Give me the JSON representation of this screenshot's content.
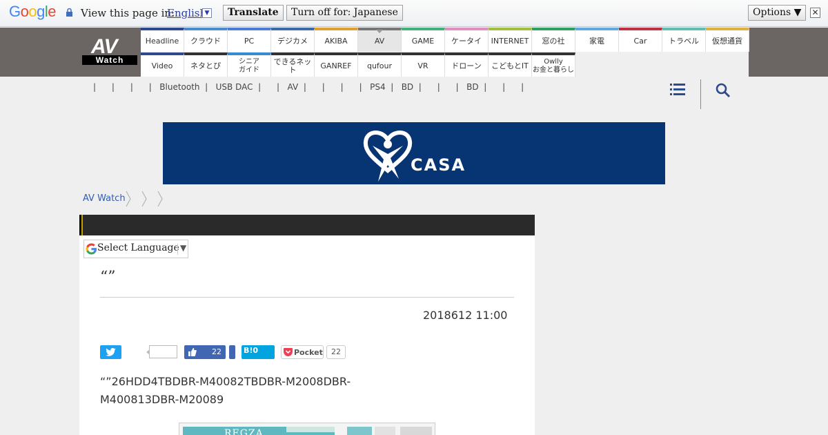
{
  "translate_bar": {
    "logo": "Google",
    "view_text": "View this page in:",
    "language": "English",
    "translate_button": "Translate",
    "turn_off_button": "Turn off for: Japanese",
    "options_button": "Options ▼",
    "close_symbol": "✕"
  },
  "site": {
    "logo_av": "AV",
    "logo_watch": "Watch"
  },
  "nav": {
    "row1": [
      {
        "label": "Headline",
        "color": "#2e4a8c"
      },
      {
        "label": "クラウド",
        "color": "#4a8cd0"
      },
      {
        "label": "PC",
        "color": "#4a7cd8"
      },
      {
        "label": "デジカメ",
        "color": "#3a6aa8"
      },
      {
        "label": "AKIBA",
        "color": "#e0a030"
      },
      {
        "label": "AV",
        "color": "#777777"
      },
      {
        "label": "GAME",
        "color": "#44b07a"
      },
      {
        "label": "ケータイ",
        "color": "#e090c0"
      },
      {
        "label": "INTERNET",
        "color": "#a0c040"
      },
      {
        "label": "窓の社",
        "color": "#30a060"
      },
      {
        "label": "家電",
        "color": "#60a8e0"
      },
      {
        "label": "Car",
        "color": "#c03040"
      },
      {
        "label": "トラベル",
        "color": "#60c0b0"
      },
      {
        "label": "仮想通貨",
        "color": "#e0b040"
      }
    ],
    "row2": [
      {
        "label": "Video",
        "color": "#2e4a8c"
      },
      {
        "label": "ネタとぴ",
        "color": "#333333"
      },
      {
        "label": "シニア\nガイド",
        "color": "#3a8ad0"
      },
      {
        "label": "できるネット",
        "color": "#333333"
      },
      {
        "label": "GANREF",
        "color": "#333333"
      },
      {
        "label": "qufour",
        "color": "#333333"
      },
      {
        "label": "VR",
        "color": "#333333"
      },
      {
        "label": "ドローン",
        "color": "#333333"
      },
      {
        "label": "こどもとIT",
        "color": "#333333"
      },
      {
        "label": "Owlly\nお金と暮らし",
        "color": "#333333"
      }
    ],
    "active": "AV"
  },
  "subnav": {
    "text": "|      |      |      |   Bluetooth  |   USB DAC  |      |   AV  |      |      |      |   PS4  |   BD  |      |      |   BD  |      |      |"
  },
  "banner": {
    "brand": "CASA"
  },
  "breadcrumb": {
    "home": "AV Watch"
  },
  "article": {
    "select_language": "Select Language",
    "title": "“”",
    "date": "2018612 11:00",
    "fb_count": "22",
    "hatena": "B!0",
    "pocket_label": "Pocket",
    "pocket_count": "22",
    "body_line1": "“”26HDD4TBDBR-M40082TBDBR-M2008DBR-",
    "body_line2": "M400813DBR-M20089",
    "image_brand": "REGZA"
  }
}
